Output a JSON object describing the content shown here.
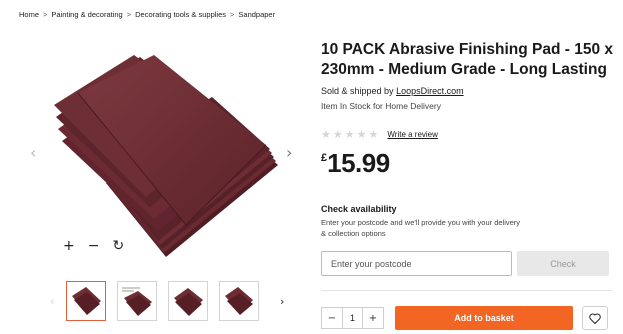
{
  "breadcrumb": [
    {
      "label": "Home"
    },
    {
      "label": "Painting & decorating"
    },
    {
      "label": "Decorating tools & supplies"
    },
    {
      "label": "Sandpaper"
    }
  ],
  "breadcrumb_separator": ">",
  "gallery": {
    "prev_arrow": "‹",
    "next_arrow": "›",
    "zoom_in": "+",
    "zoom_out": "−",
    "reset": "↻",
    "thumb_prev": "‹",
    "thumb_next": "›",
    "thumbnail_count": 4,
    "pad_color": "#6e2c33"
  },
  "product": {
    "title": "10 PACK Abrasive Finishing Pad - 150 x 230mm - Medium Grade - Long Lasting",
    "sold_by_prefix": "Sold & shipped by ",
    "seller": "LoopsDirect.com",
    "stock": "Item In Stock for Home Delivery",
    "rating_stars": 0,
    "write_review": "Write a review",
    "currency": "£",
    "price": "15.99"
  },
  "availability": {
    "title": "Check availability",
    "description": "Enter your postcode and we'll provide you with your delivery & collection options",
    "postcode_placeholder": "Enter your postcode",
    "check_label": "Check"
  },
  "purchase": {
    "minus": "−",
    "quantity": "1",
    "plus": "+",
    "add_to_basket": "Add to basket"
  },
  "colors": {
    "accent": "#f26522",
    "active_thumb_border": "#e0603a",
    "check_button_bg": "#e8e8e8"
  }
}
